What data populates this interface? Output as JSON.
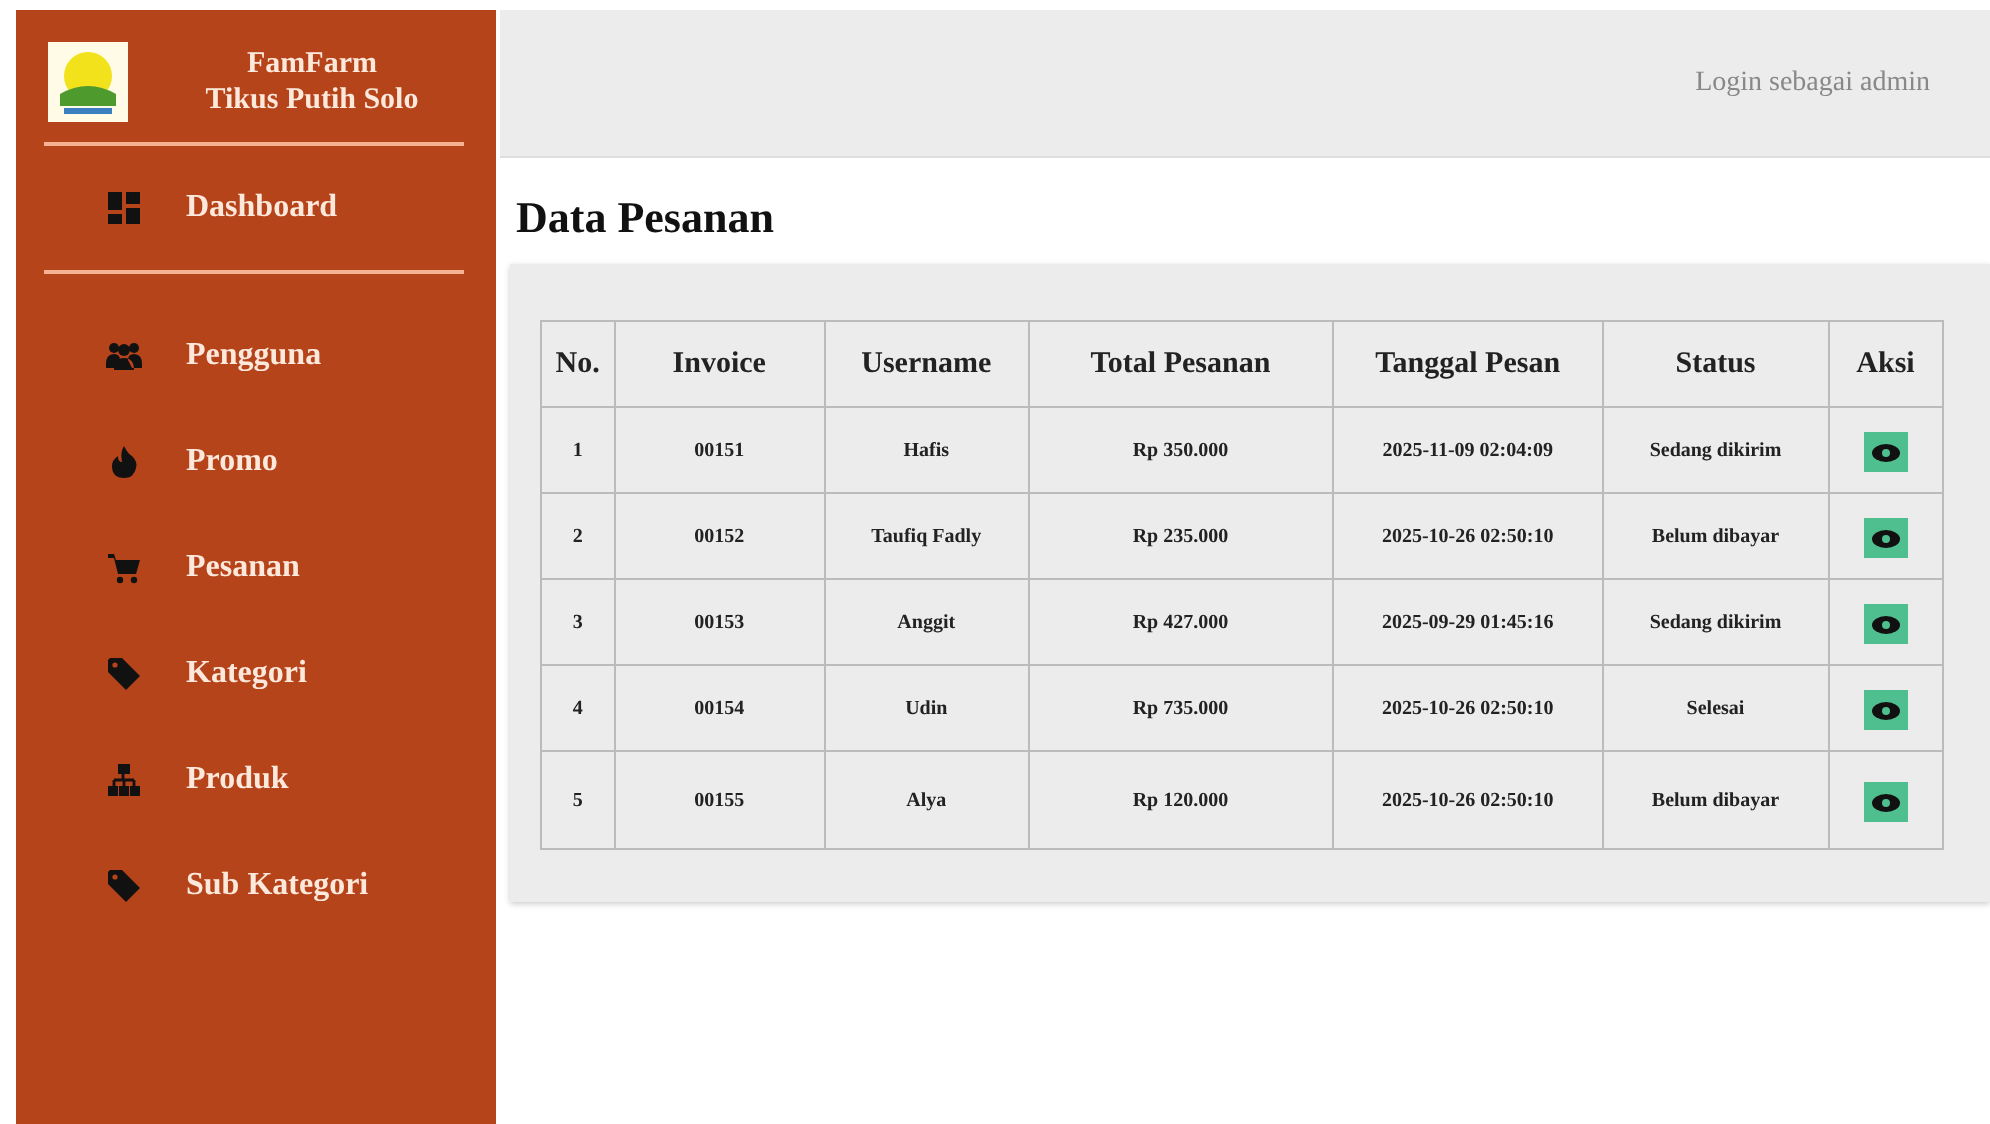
{
  "sidebar": {
    "brand": [
      "FamFarm",
      "Tikus Putih Solo"
    ],
    "top_item": {
      "label": "Dashboard",
      "kind": "dashboard"
    },
    "items": [
      {
        "label": "Pengguna",
        "kind": "users"
      },
      {
        "label": "Promo",
        "kind": "promo"
      },
      {
        "label": "Pesanan",
        "kind": "orders"
      },
      {
        "label": "Kategori",
        "kind": "category"
      },
      {
        "label": "Produk",
        "kind": "product"
      },
      {
        "label": "Sub Kategori",
        "kind": "category"
      }
    ]
  },
  "header": {
    "user_label": "Login sebagai admin"
  },
  "page_title": "Data Pesanan",
  "table": {
    "columns": [
      "No.",
      "Invoice",
      "Username",
      "Total Pesanan",
      "Tanggal Pesan",
      "Status",
      "Aksi"
    ],
    "rows": [
      {
        "no": "1",
        "invoice": "00151",
        "username": "Hafis",
        "total": "Rp 350.000",
        "date": "2025-11-09 02:04:09",
        "status": "Sedang dikirim"
      },
      {
        "no": "2",
        "invoice": "00152",
        "username": "Taufiq Fadly",
        "total": "Rp 235.000",
        "date": "2025-10-26 02:50:10",
        "status": "Belum dibayar"
      },
      {
        "no": "3",
        "invoice": "00153",
        "username": "Anggit",
        "total": "Rp 427.000",
        "date": "2025-09-29 01:45:16",
        "status": "Sedang dikirim"
      },
      {
        "no": "4",
        "invoice": "00154",
        "username": "Udin",
        "total": "Rp 735.000",
        "date": "2025-10-26 02:50:10",
        "status": "Selesai"
      },
      {
        "no": "5",
        "invoice": "00155",
        "username": "Alya",
        "total": "Rp 120.000",
        "date": "2025-10-26 02:50:10",
        "status": "Belum dibayar"
      }
    ]
  }
}
